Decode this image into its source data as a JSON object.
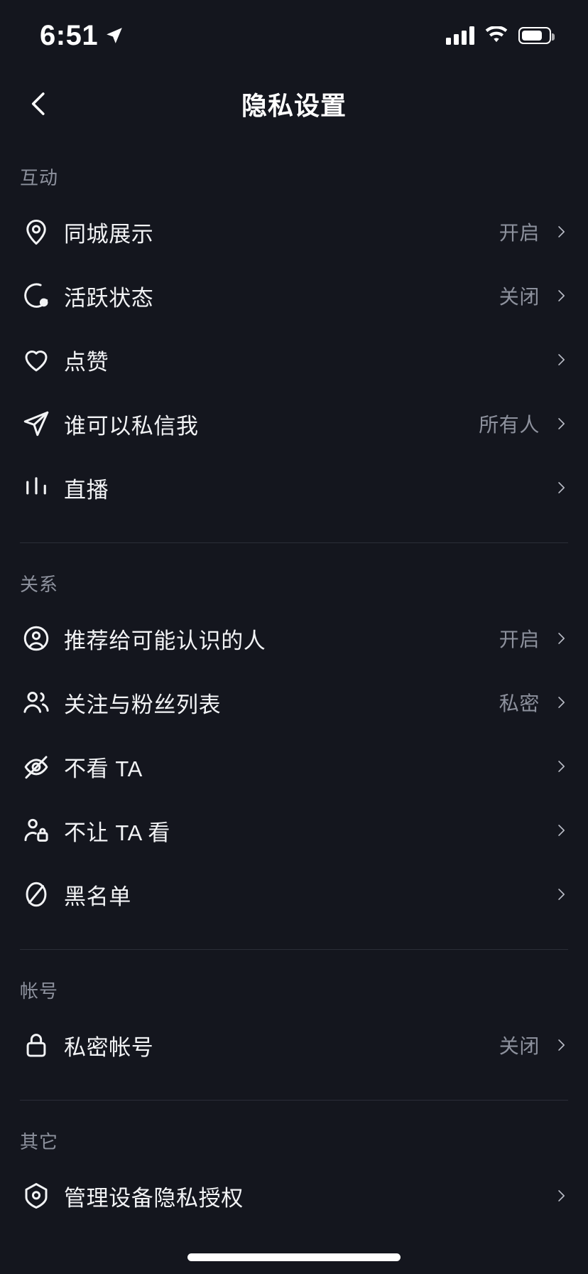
{
  "status_bar": {
    "time": "6:51",
    "location_icon": "location-arrow-icon",
    "signal_icon": "cellular-signal-icon",
    "wifi_icon": "wifi-icon",
    "battery_icon": "battery-icon"
  },
  "nav": {
    "back_icon": "chevron-left-icon",
    "title": "隐私设置"
  },
  "sections": [
    {
      "title": "互动",
      "rows": [
        {
          "icon": "location-pin-icon",
          "label": "同城展示",
          "value": "开启"
        },
        {
          "icon": "active-status-icon",
          "label": "活跃状态",
          "value": "关闭"
        },
        {
          "icon": "heart-icon",
          "label": "点赞",
          "value": ""
        },
        {
          "icon": "paper-plane-icon",
          "label": "谁可以私信我",
          "value": "所有人"
        },
        {
          "icon": "live-bars-icon",
          "label": "直播",
          "value": ""
        }
      ]
    },
    {
      "title": "关系",
      "rows": [
        {
          "icon": "user-circle-icon",
          "label": "推荐给可能认识的人",
          "value": "开启"
        },
        {
          "icon": "users-icon",
          "label": "关注与粉丝列表",
          "value": "私密"
        },
        {
          "icon": "eye-slash-icon",
          "label": "不看 TA",
          "value": ""
        },
        {
          "icon": "user-lock-icon",
          "label": "不让 TA 看",
          "value": ""
        },
        {
          "icon": "ban-circle-icon",
          "label": "黑名单",
          "value": ""
        }
      ]
    },
    {
      "title": "帐号",
      "rows": [
        {
          "icon": "lock-icon",
          "label": "私密帐号",
          "value": "关闭"
        }
      ]
    },
    {
      "title": "其它",
      "rows": [
        {
          "icon": "shield-privacy-icon",
          "label": "管理设备隐私授权",
          "value": ""
        }
      ]
    }
  ],
  "colors": {
    "background": "#14161e",
    "primary_text": "#f2f3f5",
    "secondary_text": "#8d919d",
    "divider": "#2b2e38"
  }
}
